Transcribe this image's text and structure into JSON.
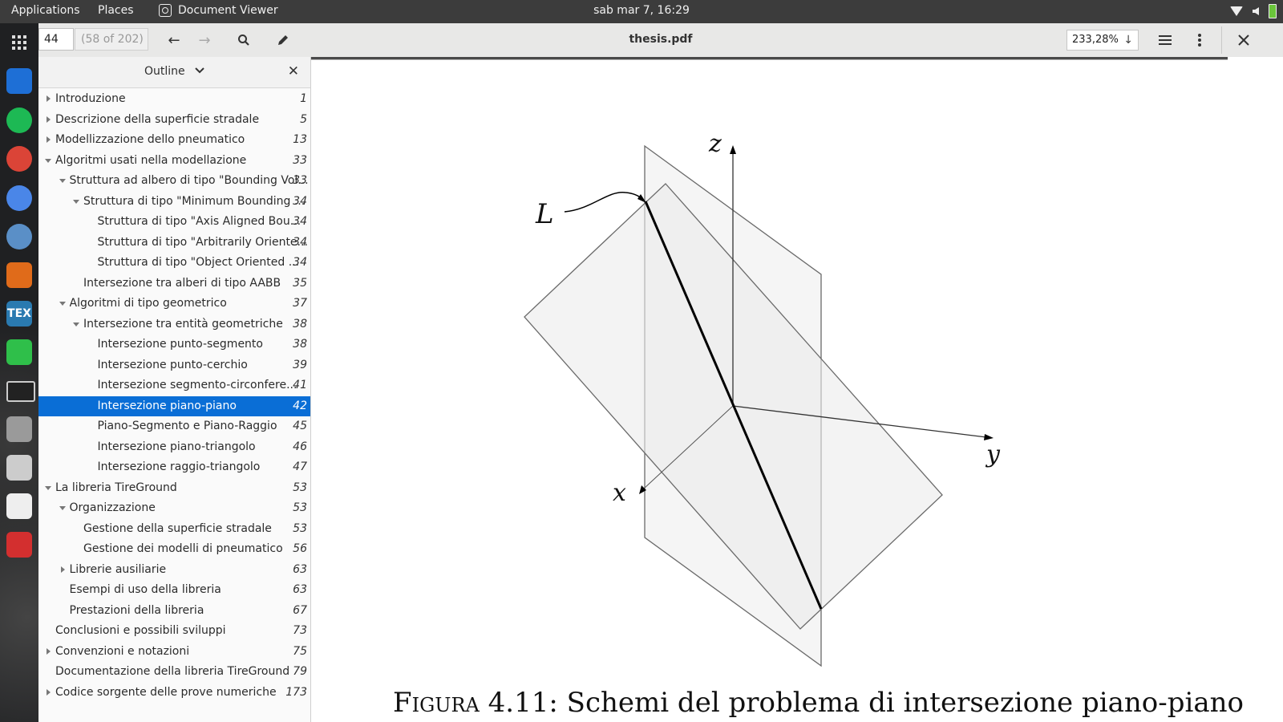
{
  "topbar": {
    "applications": "Applications",
    "places": "Places",
    "app_name": "Document Viewer",
    "clock": "sab mar  7, 16:29"
  },
  "dock": [
    {
      "icon": "app-grid-icon"
    },
    {
      "icon": "file-manager-icon",
      "color": "#1e6fd6"
    },
    {
      "icon": "spotify-icon",
      "color": "#1db954"
    },
    {
      "icon": "chrome-icon",
      "color": "#db4437"
    },
    {
      "icon": "chromium-icon",
      "color": "#4a86e8"
    },
    {
      "icon": "thunderbird-icon",
      "color": "#5a8fc7"
    },
    {
      "icon": "matlab-icon",
      "color": "#e06b1a"
    },
    {
      "icon": "texmaker-icon",
      "color": "#2a7ab0",
      "text": "TEX"
    },
    {
      "icon": "system-monitor-icon",
      "color": "#2fbf4a"
    },
    {
      "icon": "terminal-icon",
      "color": "#222222"
    },
    {
      "icon": "settings-icon",
      "color": "#9a9a9a"
    },
    {
      "icon": "download-icon",
      "color": "#cccccc"
    },
    {
      "icon": "document-editor-icon",
      "color": "#eeeeee"
    },
    {
      "icon": "acrobat-icon",
      "color": "#d32f2f"
    }
  ],
  "header": {
    "page_number": "44",
    "page_count": "(58 of 202)",
    "title": "thesis.pdf",
    "zoom": "233,28%"
  },
  "outline": {
    "title": "Outline",
    "rows": [
      {
        "label": "Introduzione",
        "page": "1",
        "level": 0,
        "toggle": "collapsed"
      },
      {
        "label": "Descrizione della superficie stradale",
        "page": "5",
        "level": 0,
        "toggle": "collapsed"
      },
      {
        "label": "Modellizzazione dello pneumatico",
        "page": "13",
        "level": 0,
        "toggle": "collapsed"
      },
      {
        "label": "Algoritmi usati nella modellazione",
        "page": "33",
        "level": 0,
        "toggle": "expanded"
      },
      {
        "label": "Struttura ad albero di tipo \"Bounding Vol...",
        "page": "33",
        "level": 1,
        "toggle": "expanded"
      },
      {
        "label": "Struttura di tipo \"Minimum Bounding ...",
        "page": "34",
        "level": 2,
        "toggle": "expanded"
      },
      {
        "label": "Struttura di tipo \"Axis Aligned Bou...",
        "page": "34",
        "level": 3,
        "toggle": ""
      },
      {
        "label": "Struttura di tipo \"Arbitrarily Oriente...",
        "page": "34",
        "level": 3,
        "toggle": ""
      },
      {
        "label": "Struttura di tipo \"Object Oriented ...",
        "page": "34",
        "level": 3,
        "toggle": ""
      },
      {
        "label": "Intersezione tra alberi di tipo AABB",
        "page": "35",
        "level": 2,
        "toggle": ""
      },
      {
        "label": "Algoritmi di tipo geometrico",
        "page": "37",
        "level": 1,
        "toggle": "expanded"
      },
      {
        "label": "Intersezione tra entità geometriche",
        "page": "38",
        "level": 2,
        "toggle": "expanded"
      },
      {
        "label": "Intersezione punto-segmento",
        "page": "38",
        "level": 3,
        "toggle": ""
      },
      {
        "label": "Intersezione punto-cerchio",
        "page": "39",
        "level": 3,
        "toggle": ""
      },
      {
        "label": "Intersezione segmento-circonfere...",
        "page": "41",
        "level": 3,
        "toggle": ""
      },
      {
        "label": "Intersezione piano-piano",
        "page": "42",
        "level": 3,
        "toggle": "",
        "selected": true
      },
      {
        "label": "Piano-Segmento e Piano-Raggio",
        "page": "45",
        "level": 3,
        "toggle": ""
      },
      {
        "label": "Intersezione piano-triangolo",
        "page": "46",
        "level": 3,
        "toggle": ""
      },
      {
        "label": "Intersezione raggio-triangolo",
        "page": "47",
        "level": 3,
        "toggle": ""
      },
      {
        "label": "La libreria TireGround",
        "page": "53",
        "level": 0,
        "toggle": "expanded"
      },
      {
        "label": "Organizzazione",
        "page": "53",
        "level": 1,
        "toggle": "expanded"
      },
      {
        "label": "Gestione della superficie stradale",
        "page": "53",
        "level": 2,
        "toggle": ""
      },
      {
        "label": "Gestione dei modelli di pneumatico",
        "page": "56",
        "level": 2,
        "toggle": ""
      },
      {
        "label": "Librerie ausiliarie",
        "page": "63",
        "level": 1,
        "toggle": "collapsed"
      },
      {
        "label": "Esempi di uso della libreria",
        "page": "63",
        "level": 1,
        "toggle": ""
      },
      {
        "label": "Prestazioni della libreria",
        "page": "67",
        "level": 1,
        "toggle": ""
      },
      {
        "label": "Conclusioni e possibili sviluppi",
        "page": "73",
        "level": 0,
        "toggle": ""
      },
      {
        "label": "Convenzioni e notazioni",
        "page": "75",
        "level": 0,
        "toggle": "collapsed"
      },
      {
        "label": "Documentazione della libreria TireGround",
        "page": "79",
        "level": 0,
        "toggle": ""
      },
      {
        "label": "Codice sorgente delle prove numeriche",
        "page": "173",
        "level": 0,
        "toggle": "collapsed"
      }
    ]
  },
  "figure": {
    "label_L": "L",
    "label_x": "x",
    "label_y": "y",
    "label_z": "z",
    "caption_prefix": "Figura 4.11:",
    "caption_text": "Schemi del problema di intersezione piano-piano"
  },
  "colors": {
    "selection": "#0a6ed6",
    "topbar": "#3c3c3c",
    "headerbar": "#e8e8e7"
  }
}
